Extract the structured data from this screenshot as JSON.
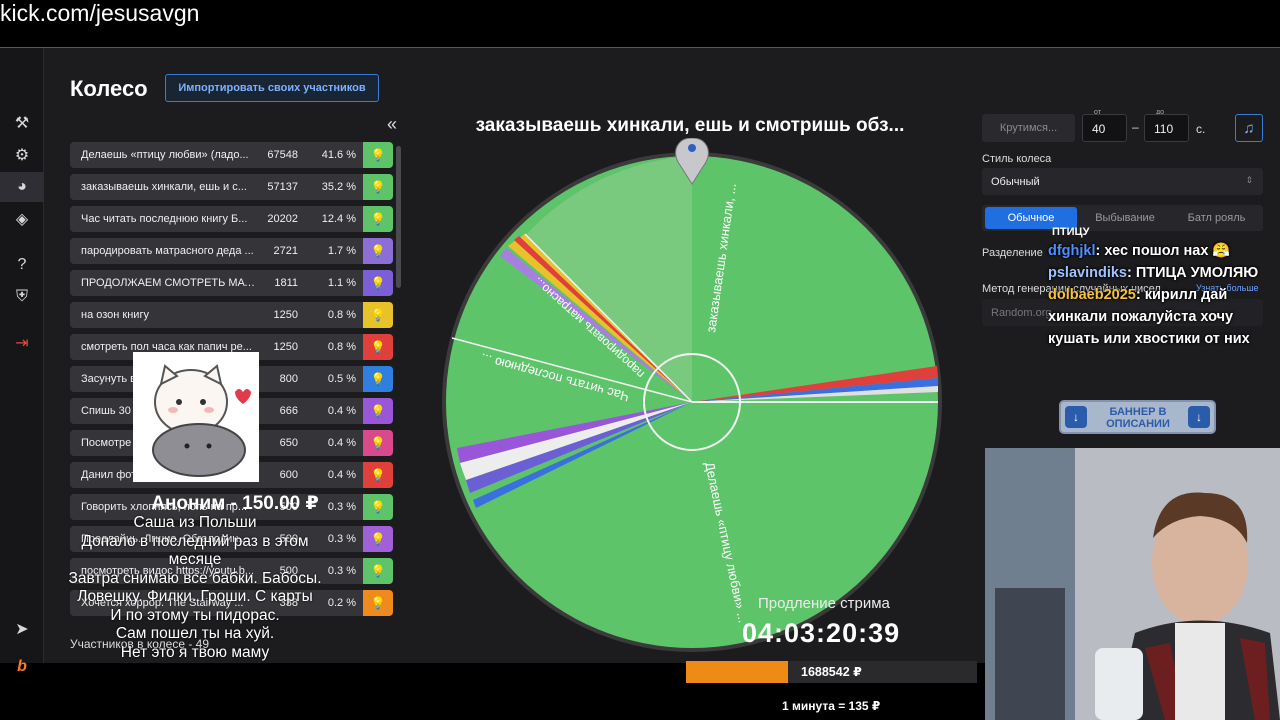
{
  "url_overlay": "kick.com/jesusavgn",
  "page": {
    "title": "Колесо",
    "import_button": "Импортировать своих участников",
    "collapse_icon": "«"
  },
  "participants": [
    {
      "label": "Делаешь «птицу любви» (ладо...",
      "count": "67548",
      "percent": "41.6 %",
      "color": "#5ec46a"
    },
    {
      "label": "заказываешь хинкали, ешь и с...",
      "count": "57137",
      "percent": "35.2 %",
      "color": "#5ec46a"
    },
    {
      "label": "Час читать последнюю книгу Б...",
      "count": "20202",
      "percent": "12.4 %",
      "color": "#5ec46a"
    },
    {
      "label": "пародировать матрасного деда ...",
      "count": "2721",
      "percent": "1.7 %",
      "color": "#8b6fd6"
    },
    {
      "label": "ПРОДОЛЖАЕМ СМОТРЕТЬ МАТР...",
      "count": "1811",
      "percent": "1.1 %",
      "color": "#7b5fd6"
    },
    {
      "label": "на озон книгу",
      "count": "1250",
      "percent": "0.8 %",
      "color": "#e8c22b"
    },
    {
      "label": "смотреть пол часа как папич ре...",
      "count": "1250",
      "percent": "0.8 %",
      "color": "#e0403c"
    },
    {
      "label": "Засунуть в",
      "count": "800",
      "percent": "0.5 %",
      "color": "#2e7fe0"
    },
    {
      "label": "Спишь 30",
      "count": "666",
      "percent": "0.4 %",
      "color": "#9a56d8"
    },
    {
      "label": "Посмотре",
      "count": "650",
      "percent": "0.4 %",
      "color": "#d84a8c"
    },
    {
      "label": "Данил фот",
      "count": "600",
      "percent": "0.4 %",
      "color": "#e0403c"
    },
    {
      "label": "Говорить хлопнясь, попь на пр...",
      "count": "500",
      "percent": "0.3 %",
      "color": "#5ec46a"
    },
    {
      "label": "Продлайць. Лгшио. Обгалодин...",
      "count": "500",
      "percent": "0.3 %",
      "color": "#a060d8"
    },
    {
      "label": "посмотреть видос https://youtu.b...",
      "count": "500",
      "percent": "0.3 %",
      "color": "#5ec46a"
    },
    {
      "label": "Хочется хоррор. The Stairway ...",
      "count": "338",
      "percent": "0.2 %",
      "color": "#ef8a1e"
    }
  ],
  "participants_count": "Участников в колесе - 49",
  "donation": {
    "name": "Аноним - 150.00 ₽",
    "message": "Саша из Польши\nДопало в последний раз в этом\nмесяце\nЗавтра снимаю все бабки. Бабосы.\nЛовешку. Филки. Гроши. С карты\nИ по этому ты пидорас.\nСам пошел ты на хуй.\nНет это я твою маму"
  },
  "wheel": {
    "winner": "заказываешь хинкали, ешь и смотришь обз...",
    "slice_labels": [
      "заказываешь хинкали, ...",
      "Делаешь «птицу любви» ...",
      "Час читать последнюю ...",
      "пародировать матрасно..."
    ]
  },
  "extension": {
    "label": "Продление стрима",
    "timer": "04:03:20:39",
    "amount": "1688542 ₽",
    "progress": 0.35,
    "rate": "1 минута = 135 ₽"
  },
  "settings": {
    "spin_button": "Крутимся...",
    "from_label": "от",
    "from_value": "40",
    "to_label": "до",
    "to_value": "110",
    "dash": "–",
    "seconds": "с.",
    "style_label": "Стиль колеса",
    "style_value": "Обычный",
    "modes": [
      "Обычное",
      "Выбывание",
      "Батл рояль"
    ],
    "split_label": "Разделение",
    "rng_label": "Метод генерации случайных чисел",
    "rng_link": "Узнать больше",
    "rng_value": "Random.org"
  },
  "chat": {
    "top_fragment": "ПТИЦУ",
    "messages": [
      {
        "user": "dfghjkl",
        "text": ": хес пошол нах 😤"
      },
      {
        "user": "pslavindiks",
        "text": ": ПТИЦА УМОЛЯЮ"
      },
      {
        "user": "dolbaeb2025",
        "text": ": кирилл дай хинкали пожалуйста хочу кушать или хвостики от них"
      }
    ]
  },
  "banner": {
    "text": "БАННЕР В ОПИСАНИИ"
  },
  "colors": {
    "wheel_green": "#5ec46a",
    "accent_blue": "#1f6fe0",
    "progress_orange": "#f08a16"
  }
}
